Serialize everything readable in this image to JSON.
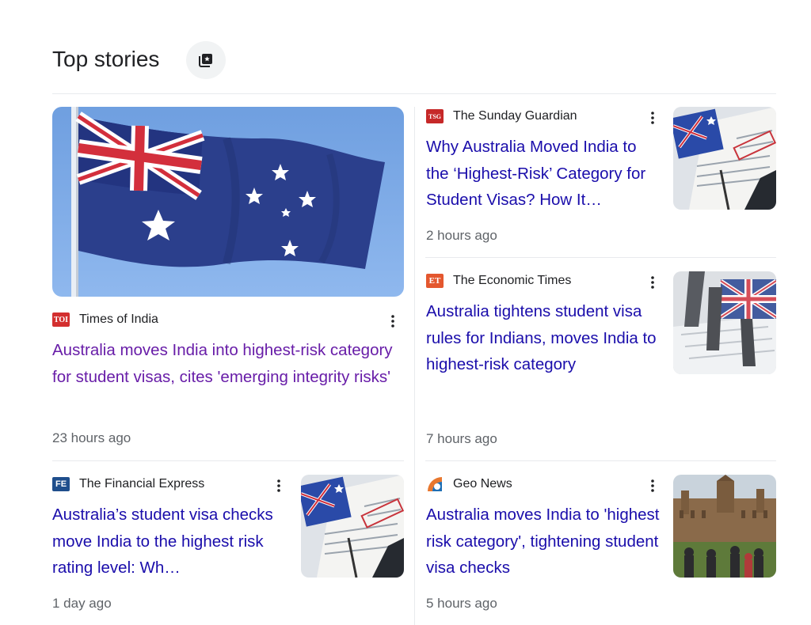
{
  "header": {
    "title": "Top stories",
    "action_icon": "stories-icon"
  },
  "stories": [
    {
      "source": "Times of India",
      "logo_text": "TOI",
      "logo_color": "#d32f2f",
      "headline": "Australia moves India into highest-risk category for student visas, cites 'emerging integrity risks'",
      "time": "23 hours ago",
      "visited": true
    },
    {
      "source": "The Sunday Guardian",
      "logo_text": "TSG",
      "logo_color": "#c62828",
      "headline": "Why Australia Moved India to the ‘Highest-Risk’ Category for Student Visas? How It…",
      "time": "2 hours ago"
    },
    {
      "source": "The Economic Times",
      "logo_text": "ET",
      "logo_color": "#e4572e",
      "headline": "Australia tightens student visa rules for Indians, moves India to highest-risk category",
      "time": "7 hours ago"
    },
    {
      "source": "The Financial Express",
      "logo_text": "FE",
      "logo_color": "#1f4e8c",
      "headline": "Australia’s student visa checks move India to the highest risk rating level: Wh…",
      "time": "1 day ago"
    },
    {
      "source": "Geo News",
      "logo_text": "",
      "logo_color": "#e8772e",
      "headline": "Australia moves India to 'highest risk category', tightening student visa checks",
      "time": "5 hours ago"
    }
  ],
  "colors": {
    "link": "#1a0dab",
    "visited_link": "#681da8",
    "meta": "#5f6368",
    "divider": "#e8eaed"
  }
}
